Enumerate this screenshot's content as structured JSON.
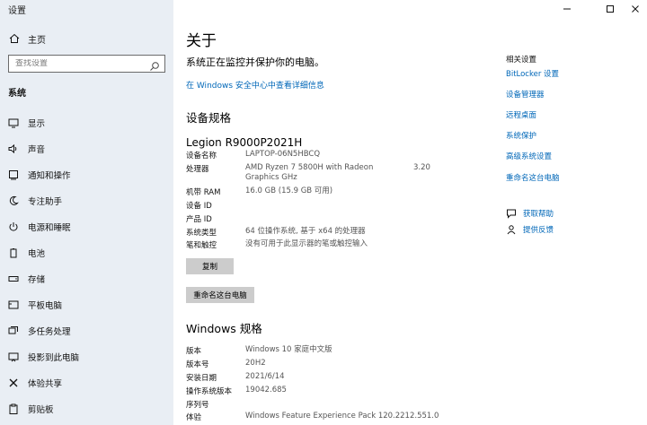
{
  "window": {
    "title": "设置"
  },
  "sidebar": {
    "home": "主页",
    "search_placeholder": "查找设置",
    "section": "系统",
    "items": [
      {
        "label": "显示",
        "icon": "display-icon"
      },
      {
        "label": "声音",
        "icon": "speaker-icon"
      },
      {
        "label": "通知和操作",
        "icon": "notification-icon"
      },
      {
        "label": "专注助手",
        "icon": "moon-icon"
      },
      {
        "label": "电源和睡眠",
        "icon": "power-icon"
      },
      {
        "label": "电池",
        "icon": "battery-icon"
      },
      {
        "label": "存储",
        "icon": "storage-icon"
      },
      {
        "label": "平板电脑",
        "icon": "tablet-icon"
      },
      {
        "label": "多任务处理",
        "icon": "multitask-icon"
      },
      {
        "label": "投影到此电脑",
        "icon": "project-icon"
      },
      {
        "label": "体验共享",
        "icon": "share-icon"
      },
      {
        "label": "剪贴板",
        "icon": "clipboard-icon"
      }
    ]
  },
  "main": {
    "title": "关于",
    "status": "系统正在监控并保护你的电脑。",
    "security_link": "在 Windows 安全中心中查看详细信息",
    "device_spec_heading": "设备规格",
    "device_name": "Legion R9000P2021H",
    "device_specs": [
      {
        "label": "设备名称",
        "value": "LAPTOP-06N5HBCQ",
        "extra": ""
      },
      {
        "label": "处理器",
        "value": "AMD Ryzen 7 5800H with Radeon Graphics GHz",
        "extra": "3.20"
      },
      {
        "label": "机带 RAM",
        "value": "16.0 GB (15.9 GB 可用)",
        "extra": ""
      },
      {
        "label": "设备 ID",
        "value": "",
        "extra": ""
      },
      {
        "label": "产品 ID",
        "value": "",
        "extra": ""
      },
      {
        "label": "系统类型",
        "value": "64 位操作系统, 基于 x64 的处理器",
        "extra": ""
      },
      {
        "label": "笔和触控",
        "value": "没有可用于此显示器的笔或触控输入",
        "extra": ""
      }
    ],
    "copy_button": "复制",
    "rename_button": "重命名这台电脑",
    "windows_spec_heading": "Windows 规格",
    "windows_specs": [
      {
        "label": "版本",
        "value": "Windows 10 家庭中文版"
      },
      {
        "label": "版本号",
        "value": "20H2"
      },
      {
        "label": "安装日期",
        "value": "2021/6/14"
      },
      {
        "label": "操作系统版本",
        "value": "19042.685"
      },
      {
        "label": "序列号",
        "value": ""
      },
      {
        "label": "体验",
        "value": "Windows Feature Experience Pack 120.2212.551.0"
      }
    ]
  },
  "related": {
    "title": "相关设置",
    "links": [
      "BitLocker 设置",
      "设备管理器",
      "远程桌面",
      "系统保护",
      "高级系统设置",
      "重命名这台电脑"
    ],
    "help": [
      {
        "label": "获取帮助",
        "icon": "help-chat-icon"
      },
      {
        "label": "提供反馈",
        "icon": "feedback-icon"
      }
    ]
  },
  "colors": {
    "accent": "#0067b8",
    "sidebar_bg": "#e9eef4",
    "button_bg": "#cccccc"
  }
}
